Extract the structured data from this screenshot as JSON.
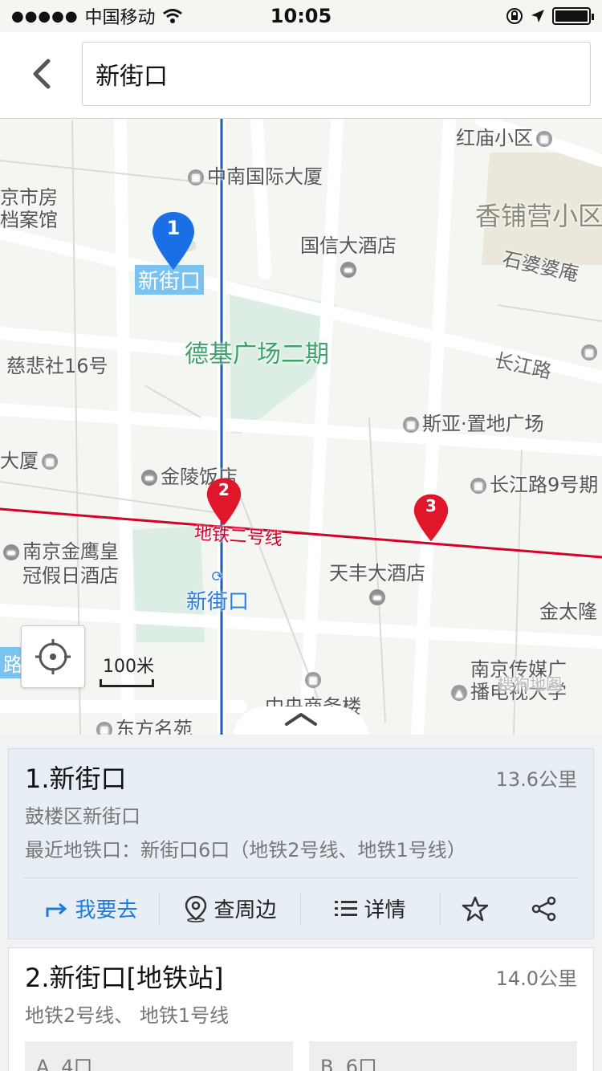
{
  "status_bar": {
    "signal": "●●●●●",
    "carrier": "中国移动",
    "time": "10:05"
  },
  "search": {
    "value": "新街口"
  },
  "map": {
    "labels": {
      "hongmiao": "红庙小区",
      "zhongnan": "中南国际大厦",
      "archive": "京市房\n档案馆",
      "archive_line1": "京市房",
      "archive_line2": "档案馆",
      "xiangpuying": "香铺营小区",
      "guoxin": "国信大酒店",
      "shipo": "石婆婆庵",
      "deji": "德基广场二期",
      "cibei": "慈悲社16号",
      "changjiang": "长江路",
      "siya": "斯亚·置地广场",
      "dasha": "大厦",
      "jinling": "金陵饭店",
      "changjiang9": "长江路9号期",
      "metro_line": "地铁二号线",
      "jinying_line1": "南京金鹰皇",
      "jinying_line2": "冠假日酒店",
      "tianfeng": "天丰大酒店",
      "station": "新街口",
      "jintai": "金太隆",
      "edge_road": "路",
      "media_line1": "南京传媒广",
      "media_line2": "播电视大学",
      "central": "中央商务楼",
      "dongfang": "东方名苑",
      "watermark": "搜狗地图",
      "pin1_label": "新街口"
    },
    "pins": [
      {
        "number": "1",
        "color": "#1a6fe6"
      },
      {
        "number": "2",
        "color": "#e0162b"
      },
      {
        "number": "3",
        "color": "#e0162b"
      }
    ],
    "scale": "100米"
  },
  "results": [
    {
      "title": "1.新街口",
      "distance": "13.6公里",
      "address": "鼓楼区新街口",
      "subway": "最近地铁口：新街口6口（地铁2号线、地铁1号线）",
      "actions": {
        "go": "我要去",
        "nearby": "查周边",
        "detail": "详情"
      }
    },
    {
      "title": "2.新街口[地铁站]",
      "distance": "14.0公里",
      "address": "地铁2号线、 地铁1号线",
      "exits": [
        "A. 4口",
        "B. 6口"
      ]
    }
  ],
  "colors": {
    "accent": "#1d7be0",
    "metro_blue": "#1a5fb4",
    "metro_red": "#d6002a",
    "map_bg": "#f3f6f1",
    "green_area": "#dceee3"
  }
}
